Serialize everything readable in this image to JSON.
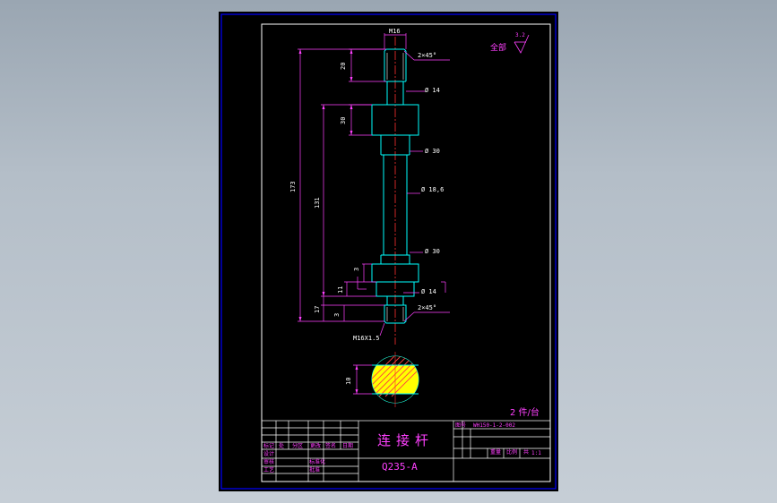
{
  "drawing": {
    "dimensions": {
      "thread_top": "M16",
      "chamfer_top": "2×45°",
      "dia_14_top": "Ø 14",
      "dia_30_top": "Ø 30",
      "dia_18_6": "Ø 18,6",
      "dia_30_bottom": "Ø 30",
      "dia_14_bottom": "Ø 14",
      "chamfer_bottom": "2×45°",
      "thread_bottom": "M16X1.5",
      "len_20": "20",
      "len_30": "30",
      "len_173": "173",
      "len_131": "131",
      "len_3a": "3",
      "len_11": "11",
      "len_17": "17",
      "len_3b": "3",
      "section_10": "10"
    },
    "surface_finish": {
      "label": "全部",
      "value": "3.2"
    },
    "quantity": "2  件/台"
  },
  "title_block": {
    "part_name": "连接杆",
    "material": "Q235-A",
    "drawing_no": "WH150-1-2-002",
    "drawing_no_label": "图号",
    "mass_label": "重量",
    "scale_label": "比例",
    "sheet_label": "共",
    "scale_value": "1:1",
    "headers": [
      "标记",
      "处",
      "分区",
      "更改",
      "签名",
      "日期"
    ],
    "row_labels": [
      "设计",
      "审核",
      "工艺",
      "标准化",
      "批准"
    ]
  },
  "colors": {
    "outline": "#00ffff",
    "dimension": "#ff40ff",
    "border": "#ffffff",
    "frame": "#0000ff",
    "center": "#ff3030",
    "hatch": "#ff4040",
    "part_fill": "#ffff00"
  }
}
